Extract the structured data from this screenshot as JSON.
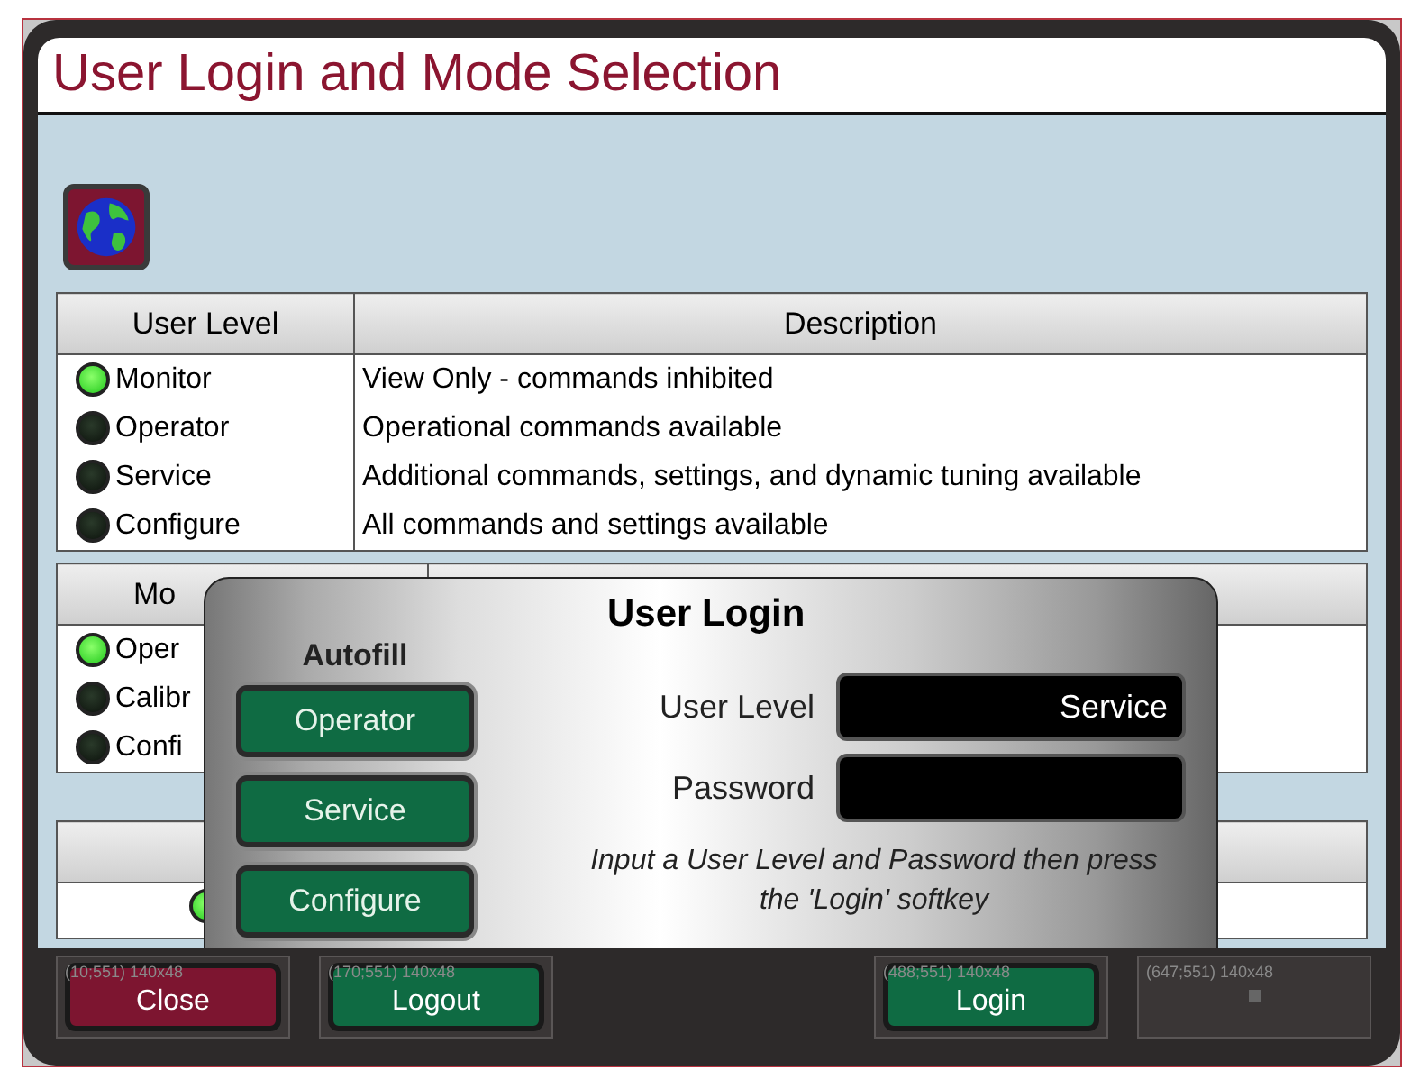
{
  "window": {
    "title": "User Login and Mode Selection"
  },
  "user_levels": {
    "columns": [
      "User Level",
      "Description"
    ],
    "rows": [
      {
        "name": "Monitor",
        "description": "View Only - commands inhibited",
        "selected": true
      },
      {
        "name": "Operator",
        "description": "Operational commands available",
        "selected": false
      },
      {
        "name": "Service",
        "description": "Additional commands, settings, and dynamic tuning available",
        "selected": false
      },
      {
        "name": "Configure",
        "description": "All commands and settings available",
        "selected": false
      }
    ]
  },
  "modes": {
    "column_1": "Mo",
    "rows": [
      {
        "name": "Oper",
        "selected": true
      },
      {
        "name": "Calibr",
        "selected": false
      },
      {
        "name": "Confi",
        "selected": false
      }
    ]
  },
  "table_3": {
    "rows": [
      {
        "selected": true
      }
    ]
  },
  "dialog": {
    "title": "User Login",
    "autofill_label": "Autofill",
    "autofill_buttons": [
      "Operator",
      "Service",
      "Configure"
    ],
    "fields": [
      {
        "label": "User Level",
        "value": "Service"
      },
      {
        "label": "Password"
      }
    ],
    "hint": "Input a User Level and Password then press the 'Login' softkey"
  },
  "softkeys": [
    {
      "kind": "red",
      "label": "Close",
      "caption": "(10;551) 140x48"
    },
    {
      "kind": "green",
      "label": "Logout",
      "caption": "(170;551) 140x48"
    },
    {
      "kind": "none"
    },
    {
      "kind": "green",
      "label": "Login",
      "caption": "(488;551) 140x48"
    },
    {
      "kind": "empty",
      "caption": "(647;551) 140x48"
    }
  ]
}
